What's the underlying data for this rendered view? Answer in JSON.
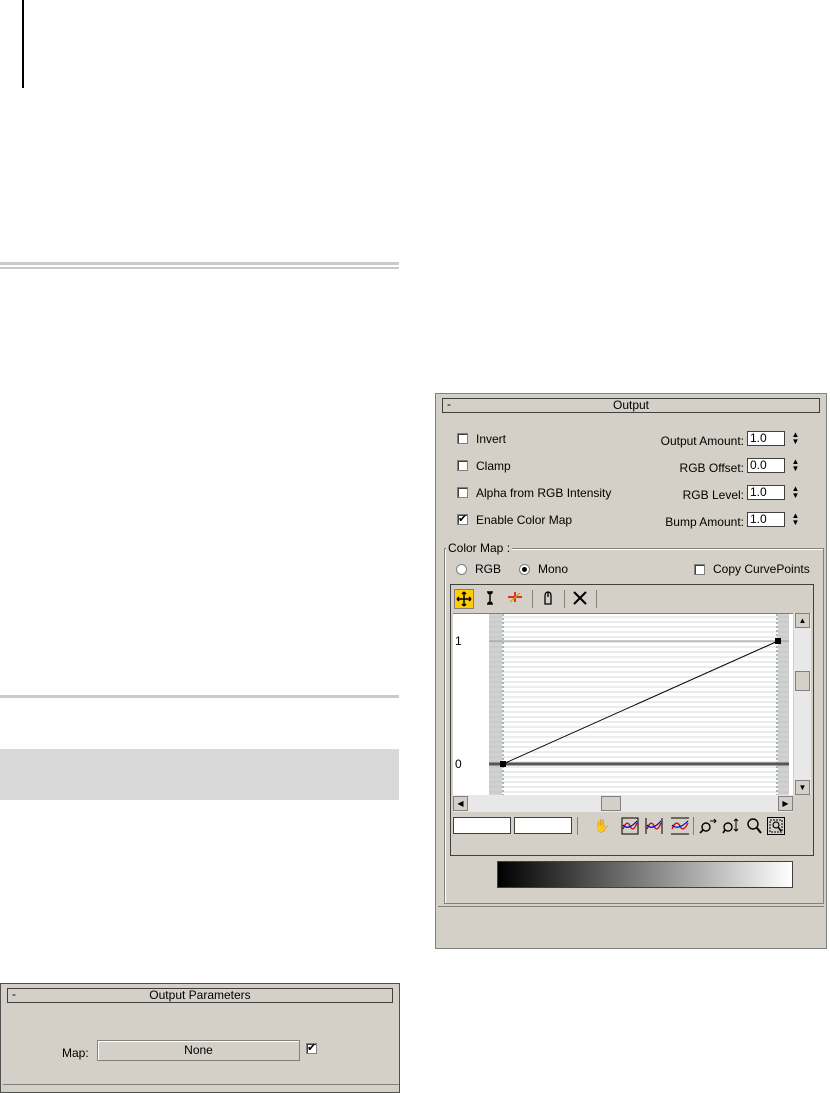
{
  "output_rollout": {
    "title": "Output",
    "collapse_symbol": "-",
    "checkboxes": [
      {
        "label": "Invert",
        "checked": false
      },
      {
        "label": "Clamp",
        "checked": false
      },
      {
        "label": "Alpha from RGB Intensity",
        "checked": false
      },
      {
        "label": "Enable Color Map",
        "checked": true
      }
    ],
    "spinners": [
      {
        "label": "Output Amount:",
        "value": "1.0"
      },
      {
        "label": "RGB Offset:",
        "value": "0.0"
      },
      {
        "label": "RGB Level:",
        "value": "1.0"
      },
      {
        "label": "Bump Amount:",
        "value": "1.0"
      }
    ],
    "color_map": {
      "group_title": "Color Map :",
      "radio_rgb": "RGB",
      "radio_mono": "Mono",
      "selected": "Mono",
      "copy_curve_points_label": "Copy CurvePoints",
      "copy_curve_points_checked": false,
      "y_label_top": "1",
      "y_label_bottom": "0",
      "toolbar_icons": [
        "move-icon",
        "scale-point-icon",
        "add-point-icon",
        "reset-curves-icon",
        "delete-point-icon"
      ],
      "bottom_icons": [
        "pan-icon",
        "zoom-extents-icon",
        "zoom-horizontal-extents-icon",
        "zoom-value-extents-icon",
        "zoom-horizontal-icon",
        "zoom-vertical-icon",
        "zoom-icon",
        "zoom-region-icon"
      ],
      "curve_points": [
        [
          0,
          0
        ],
        [
          1,
          1
        ]
      ],
      "check_mark": "✔"
    }
  },
  "output_parameters": {
    "title": "Output Parameters",
    "collapse_symbol": "-",
    "map_label": "Map:",
    "map_button": "None",
    "map_enabled": true,
    "check_mark": "✔"
  },
  "colors": {
    "panel": "#d4d0c8",
    "highlight": "#ffcc00"
  }
}
